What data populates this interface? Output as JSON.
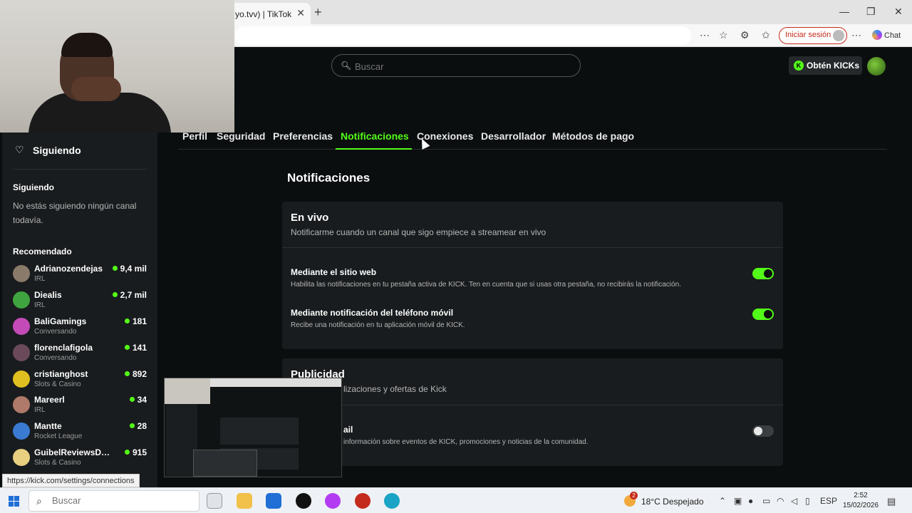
{
  "browser": {
    "tab_title": "yo.tvv) | TikTok",
    "tab_close": "✕",
    "new_tab": "+",
    "win_min": "—",
    "win_max": "❐",
    "win_close": "✕",
    "signin_label": "Iniciar sesión",
    "chat_label": "Chat"
  },
  "header": {
    "search_placeholder": "Buscar",
    "kicks_button": "Obtén KICKs",
    "kicks_badge": "K"
  },
  "tabs": [
    {
      "label": "Perfil"
    },
    {
      "label": "Seguridad"
    },
    {
      "label": "Preferencias"
    },
    {
      "label": "Notificaciones",
      "active": true
    },
    {
      "label": "Conexiones"
    },
    {
      "label": "Desarrollador"
    },
    {
      "label": "Métodos de pago"
    }
  ],
  "main": {
    "title": "Notificaciones",
    "live": {
      "title": "En vivo",
      "subtitle": "Notificarme cuando un canal que sigo empiece a streamear en vivo",
      "rows": [
        {
          "title": "Mediante el sitio web",
          "desc": "Habilita las notificaciones en tu pestaña activa de KICK. Ten en cuenta que si usas otra pestaña, no recibirás la notificación.",
          "enabled": true
        },
        {
          "title": "Mediante notificación del teléfono móvil",
          "desc": "Recibe una notificación en tu aplicación móvil de KICK.",
          "enabled": true
        }
      ]
    },
    "ads": {
      "title": "Publicidad",
      "subtitle_visible": "lizaciones y ofertas de Kick",
      "row_title_visible": "ail",
      "row_desc_visible": "información sobre eventos de KICK, promociones y noticias de la comunidad.",
      "enabled": false
    }
  },
  "sidebar": {
    "following_header": "Siguiendo",
    "following_label": "Siguiendo",
    "empty_text": "No estás siguiendo ningún canal todavía.",
    "recommended_label": "Recomendado",
    "channels": [
      {
        "name": "Adrianozendejas",
        "category": "IRL",
        "viewers": "9,4 mil",
        "color": "#8a7a6a"
      },
      {
        "name": "Diealis",
        "category": "IRL",
        "viewers": "2,7 mil",
        "color": "#3fa33f"
      },
      {
        "name": "BaliGamings",
        "category": "Conversando",
        "viewers": "181",
        "color": "#c44ab8"
      },
      {
        "name": "florenclafigola",
        "category": "Conversando",
        "viewers": "141",
        "color": "#6a4a5a"
      },
      {
        "name": "cristianghost",
        "category": "Slots & Casino",
        "viewers": "892",
        "color": "#e0c020"
      },
      {
        "name": "Mareerl",
        "category": "IRL",
        "viewers": "34",
        "color": "#b07a6a"
      },
      {
        "name": "Mantte",
        "category": "Rocket League",
        "viewers": "28",
        "color": "#3a7ad0"
      },
      {
        "name": "GuibelReviewsDirecto",
        "category": "Slots & Casino",
        "viewers": "915",
        "color": "#e8d080"
      }
    ]
  },
  "status_url": "https://kick.com/settings/connections",
  "taskbar": {
    "search_placeholder": "Buscar",
    "weather": "18°C  Despejado",
    "weather_badge": "2",
    "language": "ESP",
    "time": "2:52",
    "date": "15/02/2026"
  },
  "colors": {
    "accent": "#53fc18",
    "background": "#0b0e0f",
    "card": "#191c1e"
  }
}
